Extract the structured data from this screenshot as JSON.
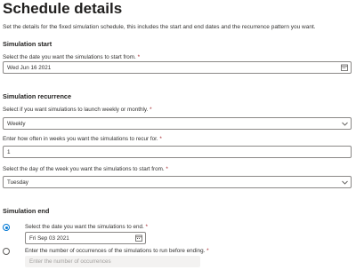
{
  "page": {
    "title": "Schedule details",
    "description": "Set the details for the fixed simulation schedule, this includes the start and end dates and the recurrence pattern you want."
  },
  "simulation_start": {
    "heading": "Simulation start",
    "date_label": "Select the date you want the simulations to start from.",
    "date_value": "Wed Jun 16 2021",
    "calendar_icon": "calendar-icon"
  },
  "simulation_recurrence": {
    "heading": "Simulation recurrence",
    "frequency_label": "Select if you want simulations to launch weekly or monthly.",
    "frequency_value": "Weekly",
    "interval_label": "Enter how often in weeks you want the simulations to recur for.",
    "interval_value": "1",
    "day_label": "Select the day of the week you want the simulations to start from.",
    "day_value": "Tuesday",
    "dropdown_icon": "chevron-down-icon"
  },
  "simulation_end": {
    "heading": "Simulation end",
    "option_date_label": "Select the date you want the simulations to end.",
    "end_date_value": "Fri Sep 03 2021",
    "option_date_selected": true,
    "option_occurrences_label": "Enter the number of occurrences of the simulations to run before ending.",
    "occurrences_placeholder": "Enter the number of occurrences",
    "option_occurrences_selected": false
  },
  "required_marker": "*",
  "colors": {
    "accent": "#0078d4",
    "required": "#a4262c",
    "border": "#8a8886"
  }
}
